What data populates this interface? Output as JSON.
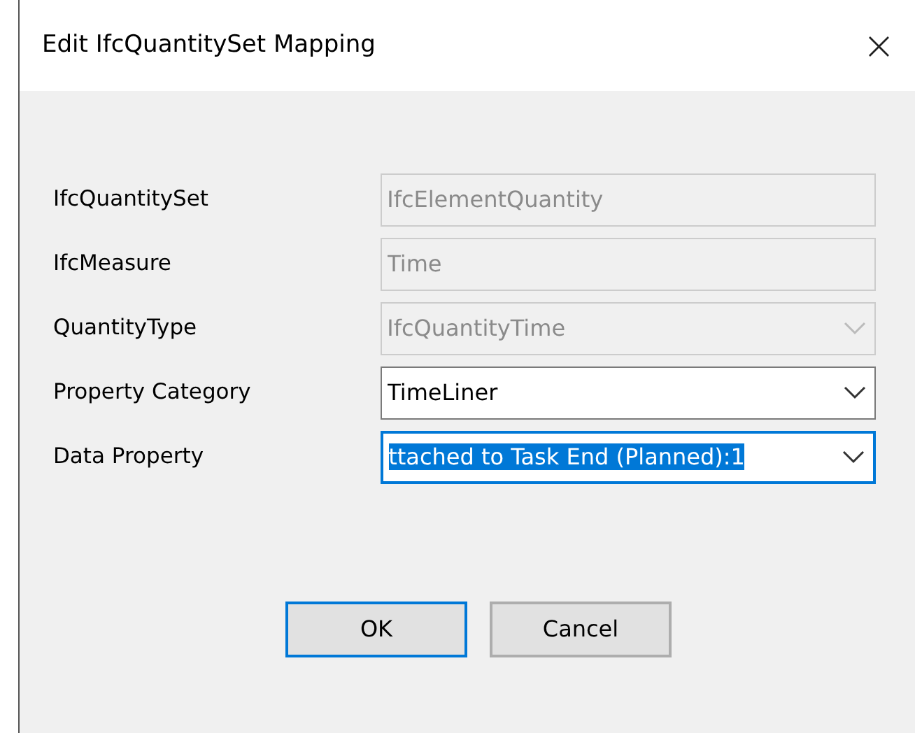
{
  "window": {
    "title": "Edit IfcQuantitySet Mapping",
    "close": "×"
  },
  "fields": [
    {
      "label": "IfcQuantitySet",
      "kind": "text",
      "value": "IfcElementQuantity",
      "disabled": true,
      "selected": false
    },
    {
      "label": "IfcMeasure",
      "kind": "text",
      "value": "Time",
      "disabled": true,
      "selected": false
    },
    {
      "label": "QuantityType",
      "kind": "combo",
      "value": "IfcQuantityTime",
      "disabled": true,
      "selected": false
    },
    {
      "label": "Property Category",
      "kind": "combo",
      "value": "TimeLiner",
      "disabled": false,
      "selected": false
    },
    {
      "label": "Data Property",
      "kind": "combo",
      "value": "ttached to Task End (Planned):1",
      "disabled": false,
      "selected": true
    }
  ],
  "buttons": [
    {
      "label": "OK",
      "default": true
    },
    {
      "label": "Cancel",
      "default": false
    }
  ]
}
